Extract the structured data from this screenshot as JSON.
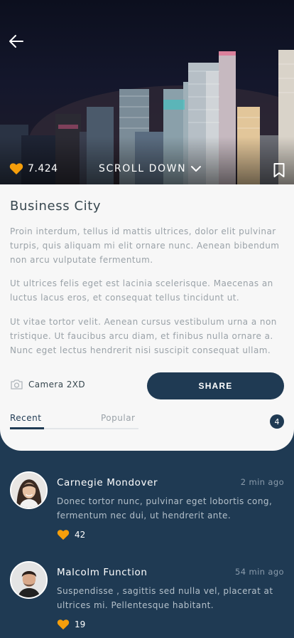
{
  "hero": {
    "likes": "7.424",
    "scroll_label": "SCROLL DOWN",
    "icons": {
      "back": "arrow-left-icon",
      "like": "heart-icon",
      "scroll": "chevron-down-icon",
      "bookmark": "bookmark-icon"
    },
    "like_color": "#f59e0b"
  },
  "article": {
    "title": "Business City",
    "paragraphs": [
      "Proin interdum, tellus id mattis ultrices, dolor elit pulvinar turpis, quis aliquam mi elit ornare nunc. Aenean bibendum non arcu vulputate fermentum.",
      "Ut ultrices felis eget est lacinia scelerisque. Maecenas an luctus lacus eros, et consequat tellus tincidunt ut.",
      "Ut vitae tortor velit. Aenean cursus vestibulum urna a non tristique. Ut faucibus arcu diam, et finibus nulla ornare a. Nunc eget lectus hendrerit nisi suscipit consequat ullam."
    ],
    "camera": "Camera 2XD",
    "share_label": "SHARE"
  },
  "tabs": {
    "items": [
      "Recent",
      "Popular"
    ],
    "active": "Recent",
    "count": "4"
  },
  "comments": [
    {
      "name": "Carnegie Mondover",
      "time": "2 min ago",
      "text": "Donec tortor nunc, pulvinar eget lobortis cong, fermentum nec dui, ut hendrerit ante.",
      "likes": "42"
    },
    {
      "name": "Malcolm Function",
      "time": "54 min ago",
      "text": "Suspendisse , sagittis sed nulla vel, placerat at ultrices mi. Pellentesque habitant.",
      "likes": "19"
    }
  ],
  "colors": {
    "primary": "#1f3a53",
    "accent": "#f59e0b",
    "card": "#f7f7f7"
  }
}
